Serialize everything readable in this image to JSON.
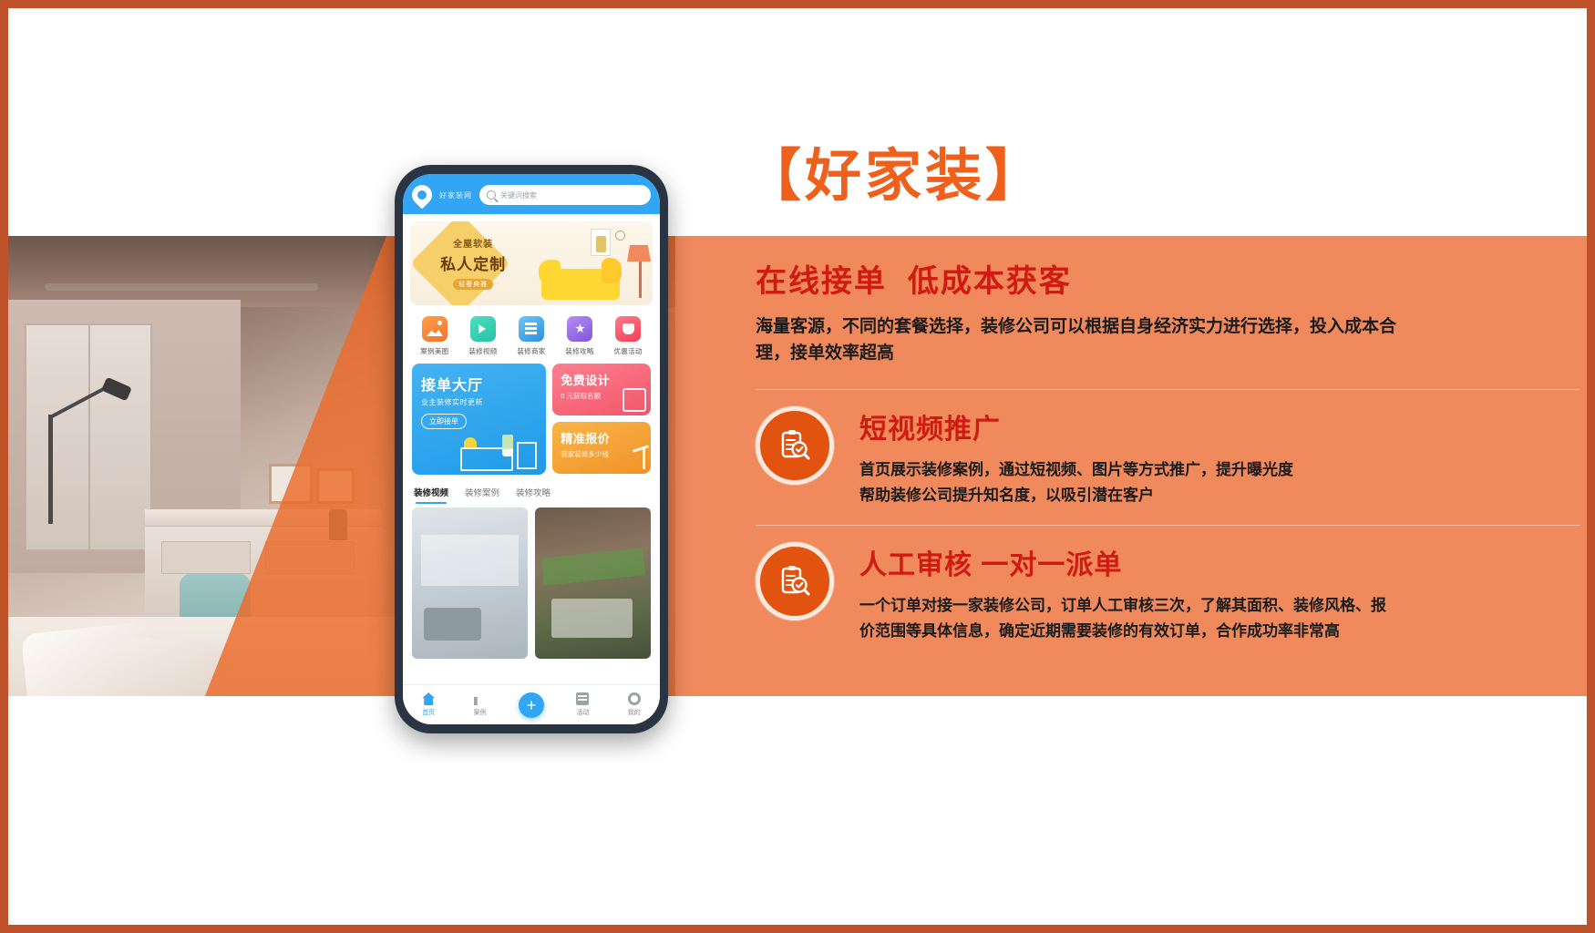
{
  "brand": {
    "title": "【好家装】"
  },
  "panel": {
    "headline": "在线接单  低成本获客",
    "headline_body": "海量客源，不同的套餐选择，装修公司可以根据自身经济实力进行选择，投入成本合理，接单效率超高",
    "sections": [
      {
        "icon": "clipboard-search-icon",
        "title": "短视频推广",
        "line1": "首页展示装修案例，通过短视频、图片等方式推广，提升曝光度",
        "line2": "帮助装修公司提升知名度，以吸引潜在客户"
      },
      {
        "icon": "clipboard-search-icon",
        "title": "人工审核 一对一派单",
        "line1": "一个订单对接一家装修公司，订单人工审核三次，了解其面积、装修风格、报",
        "line2": "价范围等具体信息，确定近期需要装修的有效订单，合作成功率非常高"
      }
    ]
  },
  "phone": {
    "header": {
      "logo_text": "好家装网",
      "search_placeholder": "关键词搜索",
      "search_icon": "search-icon"
    },
    "hero": {
      "line1": "全屋软装",
      "line2": "私人定制",
      "tag": "轻奢典雅"
    },
    "quick_icons": [
      {
        "label": "案例美图",
        "icon": "image-icon"
      },
      {
        "label": "装修视频",
        "icon": "video-icon"
      },
      {
        "label": "装修商家",
        "icon": "shop-icon"
      },
      {
        "label": "装修攻略",
        "icon": "star-book-icon"
      },
      {
        "label": "优惠活动",
        "icon": "coupon-icon"
      }
    ],
    "cards": {
      "main": {
        "title": "接单大厅",
        "subtitle": "业主装修实时更新",
        "button": "立即接单"
      },
      "side": [
        {
          "title": "免费设计",
          "subtitle": "0 元获取名额"
        },
        {
          "title": "精准报价",
          "subtitle": "我家装修多少钱"
        }
      ]
    },
    "tabs": [
      {
        "label": "装修视频",
        "active": true
      },
      {
        "label": "装修案例",
        "active": false
      },
      {
        "label": "装修攻略",
        "active": false
      }
    ],
    "nav": [
      {
        "label": "首页",
        "icon": "home-icon",
        "active": true
      },
      {
        "label": "案例",
        "icon": "case-icon",
        "active": false
      },
      {
        "label": "",
        "icon": "plus-icon",
        "active": false
      },
      {
        "label": "活动",
        "icon": "activity-icon",
        "active": false
      },
      {
        "label": "我的",
        "icon": "profile-icon",
        "active": false
      }
    ],
    "nav_plus": "+"
  },
  "colors": {
    "brand_orange": "#f0601d",
    "panel_orange": "#f08a5d",
    "title_red": "#d01b10",
    "badge_orange": "#e2530f",
    "app_blue": "#32a5f5",
    "border": "#c0522a"
  }
}
